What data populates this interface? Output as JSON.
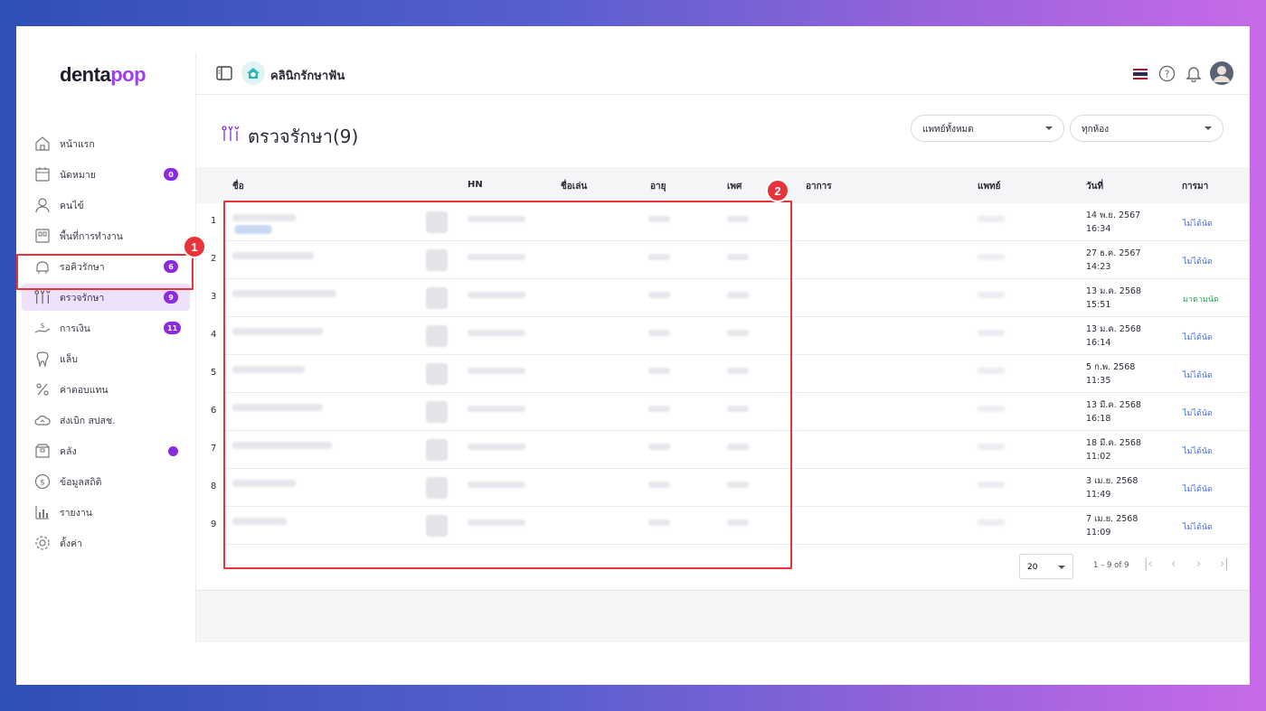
{
  "app": {
    "logo_main": "denta",
    "logo_accent": "pop",
    "logo_end": "p"
  },
  "topbar": {
    "clinic_name": "คลินิกรักษาฟัน"
  },
  "sidebar": {
    "items": [
      {
        "label": "หน้าแรก",
        "icon": "home-icon"
      },
      {
        "label": "นัดหมาย",
        "icon": "calendar-icon",
        "badge": "0"
      },
      {
        "label": "คนไข้",
        "icon": "person-icon"
      },
      {
        "label": "พื้นที่การทำงาน",
        "icon": "workspace-icon"
      },
      {
        "label": "รอคิวรักษา",
        "icon": "dental-chair-icon",
        "badge": "6"
      },
      {
        "label": "ตรวจรักษา",
        "icon": "dental-tools-icon",
        "badge": "9"
      },
      {
        "label": "การเงิน",
        "icon": "money-icon",
        "badge": "11"
      },
      {
        "label": "แล็บ",
        "icon": "tooth-icon"
      },
      {
        "label": "ค่าตอบแทน",
        "icon": "percent-icon"
      },
      {
        "label": "ส่งเบิก สปสช.",
        "icon": "cloud-icon"
      },
      {
        "label": "คลัง",
        "icon": "box-icon"
      },
      {
        "label": "ข้อมูลสถิติ",
        "icon": "stats-icon"
      },
      {
        "label": "รายงาน",
        "icon": "report-icon"
      },
      {
        "label": "ตั้งค่า",
        "icon": "settings-icon"
      }
    ]
  },
  "callouts": {
    "first": "1",
    "second": "2"
  },
  "page": {
    "title": "ตรวจรักษา(9)",
    "doctor_filter": "แพทย์ทั้งหมด",
    "room_filter": "ทุกห้อง"
  },
  "table": {
    "headers": {
      "name": "ชื่อ",
      "hn": "HN",
      "nickname": "ชื่อเล่น",
      "age": "อายุ",
      "sex": "เพศ",
      "symptom": "อาการ",
      "doctor": "แพทย์",
      "date": "วันที่",
      "arrival": "การมา"
    },
    "rows": [
      {
        "no": "1",
        "date": "14 พ.ย. 2567",
        "time": "16:34",
        "status": "ไม่ได้นัด",
        "status_kind": "no"
      },
      {
        "no": "2",
        "date": "27 ธ.ค. 2567",
        "time": "14:23",
        "status": "ไม่ได้นัด",
        "status_kind": "no"
      },
      {
        "no": "3",
        "date": "13 ม.ค. 2568",
        "time": "15:51",
        "status": "มาตามนัด",
        "status_kind": "ok"
      },
      {
        "no": "4",
        "date": "13 ม.ค. 2568",
        "time": "16:14",
        "status": "ไม่ได้นัด",
        "status_kind": "no"
      },
      {
        "no": "5",
        "date": "5 ก.พ. 2568",
        "time": "11:35",
        "status": "ไม่ได้นัด",
        "status_kind": "no"
      },
      {
        "no": "6",
        "date": "13 มี.ค. 2568",
        "time": "16:18",
        "status": "ไม่ได้นัด",
        "status_kind": "no"
      },
      {
        "no": "7",
        "date": "18 มี.ค. 2568",
        "time": "11:02",
        "status": "ไม่ได้นัด",
        "status_kind": "no"
      },
      {
        "no": "8",
        "date": "3 เม.ย. 2568",
        "time": "11:49",
        "status": "ไม่ได้นัด",
        "status_kind": "no"
      },
      {
        "no": "9",
        "date": "7 เม.ย. 2568",
        "time": "11:09",
        "status": "ไม่ได้นัด",
        "status_kind": "no"
      }
    ]
  },
  "pager": {
    "page_size": "20",
    "range": "1 – 9 of 9"
  },
  "colors": {
    "accent": "#8a2be2",
    "highlight": "#e8333a",
    "link": "#3d6de0",
    "ok": "#26a655"
  }
}
